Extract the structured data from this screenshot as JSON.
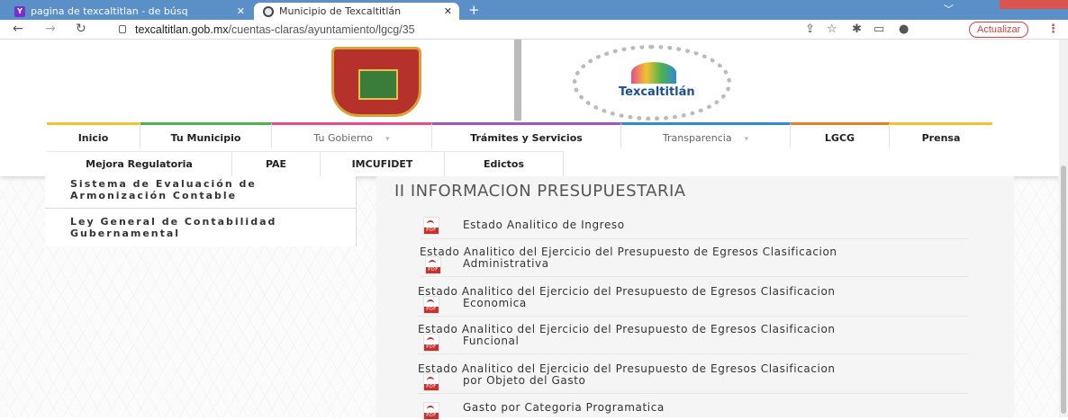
{
  "browser": {
    "tabs": [
      {
        "title": "pagina de texcaltitlan - de búsq"
      },
      {
        "title": "Municipio de Texcaltitlán"
      }
    ],
    "url_host": "texcaltitlan.gob.mx",
    "url_path": "/cuentas-claras/ayuntamiento/lgcg/35",
    "update_label": "Actualizar"
  },
  "header": {
    "logo_text": "Texcaltitlán"
  },
  "menu": {
    "row1": [
      "Inicio",
      "Tu Municipio",
      "Tu Gobierno",
      "Trámites y Servicios",
      "Transparencia",
      "LGCG",
      "Prensa"
    ],
    "row2": [
      "Mejora Regulatoria",
      "PAE",
      "IMCUFIDET",
      "Edictos"
    ]
  },
  "sidebar": {
    "items": [
      {
        "label": "Sistema de Evaluación de Armonización Contable"
      },
      {
        "label": "Ley General de Contabilidad Gubernamental"
      }
    ]
  },
  "content": {
    "title": "II INFORMACION PRESUPUESTARIA",
    "documents": [
      {
        "label": "Estado Analitico de Ingreso"
      },
      {
        "label1": "Estado Analitico del Ejercicio del Presupuesto de Egresos Clasificacion",
        "label2": "Administrativa"
      },
      {
        "label1": "Estado Analitico del Ejercicio del Presupuesto de Egresos Clasificacion",
        "label2": "Economica"
      },
      {
        "label1": "Estado Analitico del Ejercicio del Presupuesto de Egresos Clasificacion",
        "label2": "Funcional"
      },
      {
        "label1": "Estado Analitico del Ejercicio del Presupuesto de Egresos Clasificacion",
        "label2": "por Objeto del Gasto"
      },
      {
        "label": "Gasto por Categoria Programatica"
      }
    ]
  },
  "colors": {
    "tabbar": "#5a8fc8",
    "pdf_red": "#c9302c",
    "update_red": "#cc4444"
  }
}
